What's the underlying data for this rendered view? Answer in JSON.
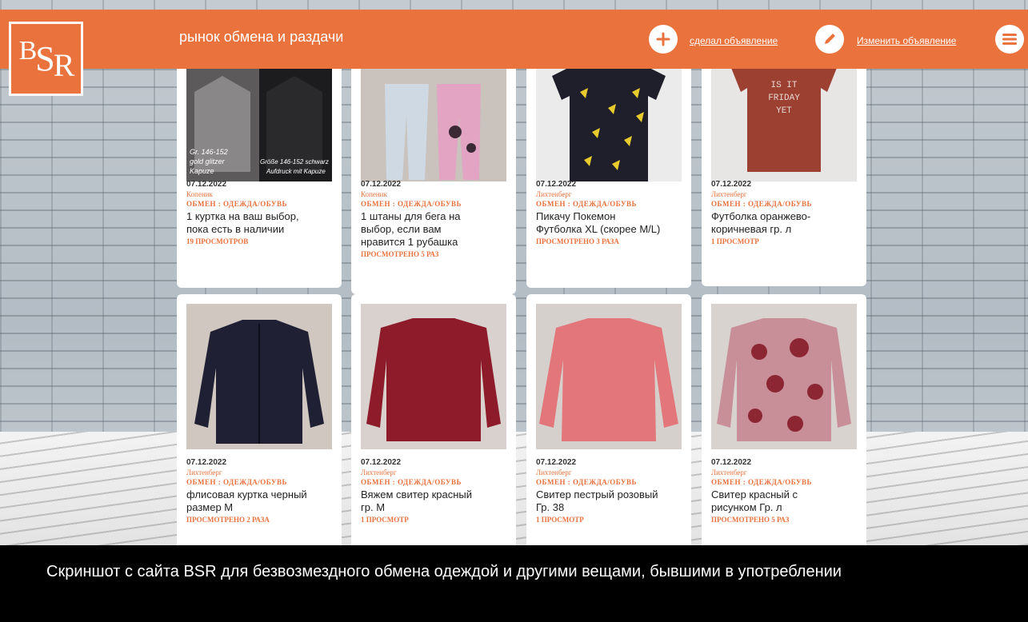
{
  "header": {
    "logo_text": "BSR",
    "tagline": "рынок обмена и раздачи",
    "add_link": "сделал объявление",
    "edit_link": "Изменить объявление",
    "brand_color": "#e9723d"
  },
  "listings": [
    {
      "date": "07.12.2022",
      "location": "Копеник",
      "category": "ОБМЕН : ОДЕЖДА/ОБУВЬ",
      "title_l1": "1 куртка на ваш выбор,",
      "title_l2": "пока есть в наличии",
      "title_l3": "",
      "views": "19 ПРОСМОТРОВ",
      "image_note_1": "Gr. 146-152",
      "image_note_2": "gold glitzer",
      "image_note_3": "Kapuze",
      "image_note_4": "Größe 146-152 schwarz",
      "image_note_5": "Aufdruck mit Kapuze"
    },
    {
      "date": "07.12.2022",
      "location": "Копеник",
      "category": "ОБМЕН : ОДЕЖДА/ОБУВЬ",
      "title_l1": "1 штаны для бега на",
      "title_l2": "выбор, если вам",
      "title_l3": "нравится 1 рубашка",
      "views": "ПРОСМОТРЕНО 5 РАЗ"
    },
    {
      "date": "07.12.2022",
      "location": "Лихтенберг",
      "category": "ОБМЕН : ОДЕЖДА/ОБУВЬ",
      "title_l1": "Пикачу Покемон",
      "title_l2": "Футболка XL (скорее M/L)",
      "title_l3": "",
      "views": "ПРОСМОТРЕНО 3 РАЗА"
    },
    {
      "date": "07.12.2022",
      "location": "Лихтенберг",
      "category": "ОБМЕН : ОДЕЖДА/ОБУВЬ",
      "title_l1": "Футболка оранжево-",
      "title_l2": "коричневая гр. л",
      "title_l3": "",
      "views": "1 ПРОСМОТР",
      "image_note_1": "IS IT",
      "image_note_2": "FRIDAY",
      "image_note_3": "YET"
    },
    {
      "date": "07.12.2022",
      "location": "Лихтенберг",
      "category": "ОБМЕН : ОДЕЖДА/ОБУВЬ",
      "title_l1": "флисовая куртка черный",
      "title_l2": "размер М",
      "title_l3": "",
      "views": "ПРОСМОТРЕНО 2 РАЗА"
    },
    {
      "date": "07.12.2022",
      "location": "Лихтенберг",
      "category": "ОБМЕН : ОДЕЖДА/ОБУВЬ",
      "title_l1": "Вяжем свитер красный",
      "title_l2": "гр. М",
      "title_l3": "",
      "views": "1 ПРОСМОТР"
    },
    {
      "date": "07.12.2022",
      "location": "Лихтенберг",
      "category": "ОБМЕН : ОДЕЖДА/ОБУВЬ",
      "title_l1": "Свитер пестрый розовый",
      "title_l2": "Гр. 38",
      "title_l3": "",
      "views": "1 ПРОСМОТР"
    },
    {
      "date": "07.12.2022",
      "location": "Лихтенберг",
      "category": "ОБМЕН : ОДЕЖДА/ОБУВЬ",
      "title_l1": "Свитер красный с",
      "title_l2": "рисунком Гр. л",
      "title_l3": "",
      "views": "ПРОСМОТРЕНО 5 РАЗ"
    }
  ],
  "caption": "Скриншот с сайта BSR для безвозмездного обмена одеждой и другими вещами, бывшими в употреблении"
}
